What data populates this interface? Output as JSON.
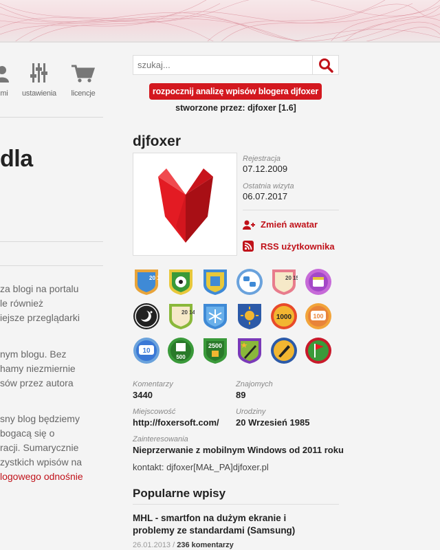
{
  "nav": {
    "items": [
      {
        "label": "mi",
        "icon": "user-icon"
      },
      {
        "label": "ustawienia",
        "icon": "sliders-icon"
      },
      {
        "label": "licencje",
        "icon": "cart-icon"
      }
    ]
  },
  "left": {
    "title": "dla",
    "paragraphs": [
      [
        "za blogi na portalu",
        "le również",
        "iejsze przeglądarki"
      ],
      [
        "nym blogu. Bez",
        "hamy niezmiernie",
        "sów przez autora"
      ],
      [
        "sny blog będziemy",
        "bogacą się o",
        "racji. Sumarycznie",
        "zystkich wpisów na"
      ],
      [
        "logowego odnośnie"
      ]
    ]
  },
  "search": {
    "placeholder": "szukaj...",
    "icon": "search-icon"
  },
  "analyze_button": "rozpocznij analizę wpisów blogera djfoxer",
  "created_by": "stworzone przez: djfoxer [1.6]",
  "profile": {
    "username": "djfoxer",
    "registration_label": "Rejestracja",
    "registration_value": "07.12.2009",
    "last_visit_label": "Ostatnia wizyta",
    "last_visit_value": "06.07.2017",
    "change_avatar": "Zmień awatar",
    "rss": "RSS użytkownika"
  },
  "badges": {
    "row1": [
      {
        "icon": "badge-2016-icon",
        "text": "20 16",
        "color": "#e8a43a"
      },
      {
        "icon": "badge-football-icon",
        "text": "",
        "color": "#3a9a3a"
      },
      {
        "icon": "badge-lumia-icon",
        "text": "",
        "color": "#3f8ad6"
      },
      {
        "icon": "badge-chat-icon",
        "text": "",
        "color": "#6aa2dc"
      },
      {
        "icon": "badge-2015-icon",
        "text": "20 15",
        "color": "#e87c8c"
      },
      {
        "icon": "badge-calendar-icon",
        "text": "",
        "color": "#a448c8"
      }
    ],
    "row2": [
      {
        "icon": "badge-night-icon",
        "text": "",
        "color": "#222222"
      },
      {
        "icon": "badge-2014-icon",
        "text": "20 14",
        "color": "#e8c83a"
      },
      {
        "icon": "badge-snowflake-icon",
        "text": "",
        "color": "#3f8ad6"
      },
      {
        "icon": "badge-sun-icon",
        "text": "",
        "color": "#2c5aa8"
      },
      {
        "icon": "badge-1000-icon",
        "text": "1000",
        "color": "#e84a2a"
      },
      {
        "icon": "badge-100-icon",
        "text": "100",
        "color": "#e8843a"
      }
    ],
    "row3": [
      {
        "icon": "badge-10-icon",
        "text": "10",
        "color": "#3a78d6"
      },
      {
        "icon": "badge-500-icon",
        "text": "500",
        "color": "#3a9a3a"
      },
      {
        "icon": "badge-2500-icon",
        "text": "2500",
        "color": "#3a9a3a"
      },
      {
        "icon": "badge-pen-star-icon",
        "text": "",
        "color": "#7a3ab8"
      },
      {
        "icon": "badge-pen-icon",
        "text": "",
        "color": "#2c5aa8"
      },
      {
        "icon": "badge-flag-icon",
        "text": "",
        "color": "#c81a2a"
      }
    ]
  },
  "stats": {
    "comments_label": "Komentarzy",
    "comments_value": "3440",
    "friends_label": "Znajomych",
    "friends_value": "89",
    "city_label": "Miejscowość",
    "city_value": "http://foxersoft.com/",
    "birthday_label": "Urodziny",
    "birthday_value": "20 Wrzesień 1985",
    "interests_label": "Zainteresowania",
    "interests_value": "Nieprzerwanie z mobilnym Windows od 2011 roku",
    "contact": "kontakt: djfoxer[MAŁ_PA]djfoxer.pl"
  },
  "popular": {
    "title": "Popularne wpisy",
    "post_title": "MHL - smartfon na dużym ekranie i problemy ze standardami (Samsung)",
    "post_date": "26.01.2013",
    "post_sep": " / ",
    "post_comments": "236 komentarzy"
  },
  "colors": {
    "accent": "#d3181f",
    "link": "#c0121a"
  }
}
